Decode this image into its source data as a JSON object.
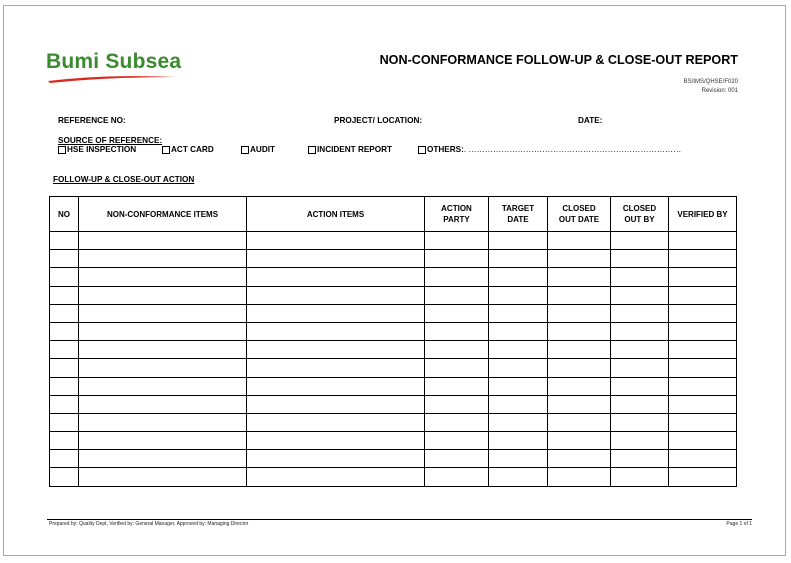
{
  "header": {
    "logo_text": "Bumi Subsea",
    "logo_color": "#3a8a2e",
    "swoosh_color": "#d9281e",
    "title": "NON-CONFORMANCE FOLLOW-UP & CLOSE-OUT REPORT",
    "doc_code": "BS/IMS/QHSE/F020",
    "revision": "Revision: 001"
  },
  "fields": {
    "reference_no": "REFERENCE NO:",
    "project_location": "PROJECT/ LOCATION:",
    "date": "DATE:"
  },
  "source": {
    "heading": "SOURCE OF REFERENCE:",
    "options": [
      "HSE INSPECTION",
      "ACT CARD",
      "AUDIT",
      "INCIDENT REPORT",
      "OTHERS:"
    ],
    "others_dots": ". ……………………………………………………………………"
  },
  "section_title": "FOLLOW-UP & CLOSE-OUT ACTION",
  "table": {
    "columns": [
      "NO",
      "NON-CONFORMANCE ITEMS",
      "ACTION ITEMS",
      "ACTION PARTY",
      "TARGET DATE",
      "CLOSED OUT DATE",
      "CLOSED OUT BY",
      "VERIFIED BY"
    ],
    "empty_rows": 14
  },
  "footer": {
    "left": "Prepared by: Quality Dept, Verified by: General Manager, Approved by: Managing Director",
    "right": "Page 1 of 1"
  }
}
